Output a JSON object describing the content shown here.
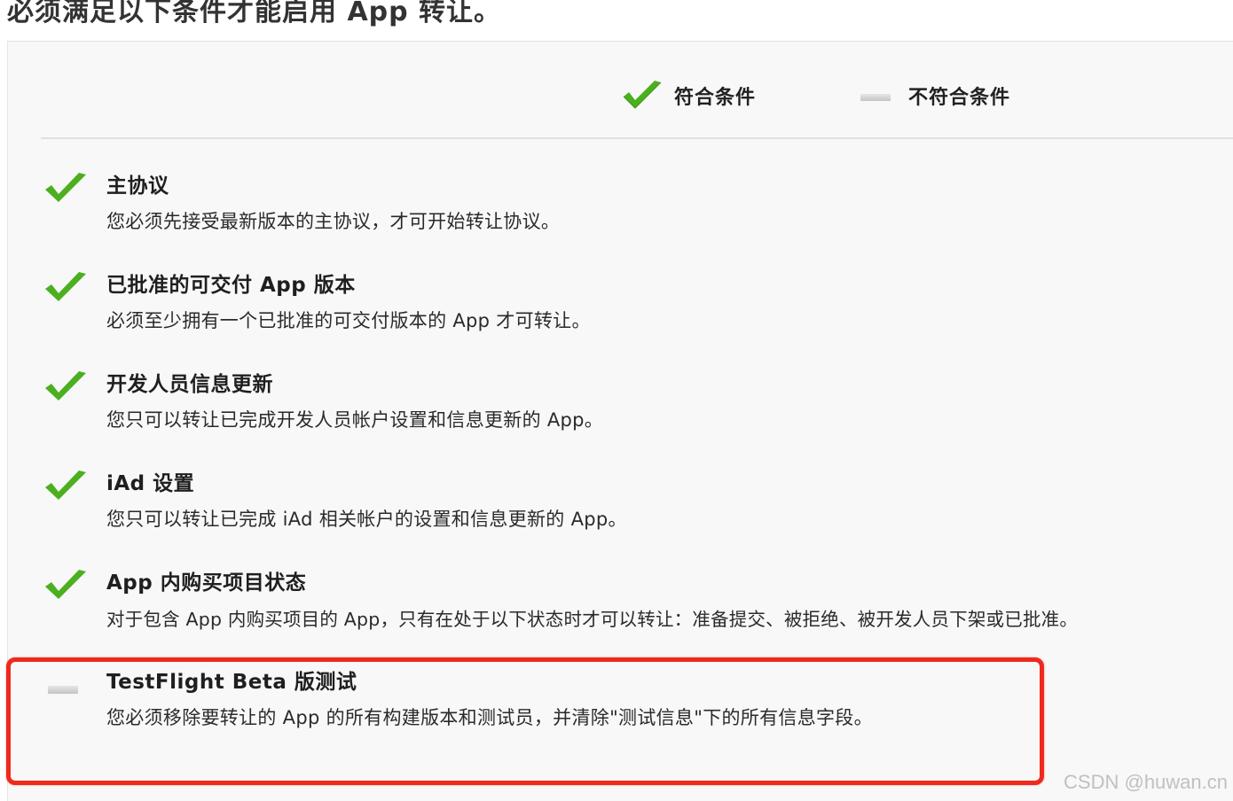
{
  "page_title": "必须满足以下条件才能启用 App 转让。",
  "legend": {
    "met_label": "符合条件",
    "unmet_label": "不符合条件",
    "met_icon": "checkmark-icon",
    "unmet_icon": "dash-icon"
  },
  "requirements": [
    {
      "title": "主协议",
      "description": "您必须先接受最新版本的主协议，才可开始转让协议。",
      "status": "met",
      "icon": "checkmark-icon"
    },
    {
      "title": "已批准的可交付 App 版本",
      "description": "必须至少拥有一个已批准的可交付版本的 App 才可转让。",
      "status": "met",
      "icon": "checkmark-icon"
    },
    {
      "title": "开发人员信息更新",
      "description": "您只可以转让已完成开发人员帐户设置和信息更新的 App。",
      "status": "met",
      "icon": "checkmark-icon"
    },
    {
      "title": "iAd 设置",
      "description": "您只可以转让已完成 iAd 相关帐户的设置和信息更新的 App。",
      "status": "met",
      "icon": "checkmark-icon"
    },
    {
      "title": "App 内购买项目状态",
      "description": "对于包含 App 内购买项目的 App，只有在处于以下状态时才可以转让：准备提交、被拒绝、被开发人员下架或已批准。",
      "status": "met",
      "icon": "checkmark-icon"
    },
    {
      "title": "TestFlight Beta 版测试",
      "description": "您必须移除要转让的 App 的所有构建版本和测试员，并清除\"测试信息\"下的所有信息字段。",
      "status": "unmet",
      "icon": "dash-icon"
    }
  ],
  "colors": {
    "check_green": "#4caf1f",
    "highlight_red": "#ee2a1c"
  },
  "watermark": "CSDN @huwan.cn"
}
